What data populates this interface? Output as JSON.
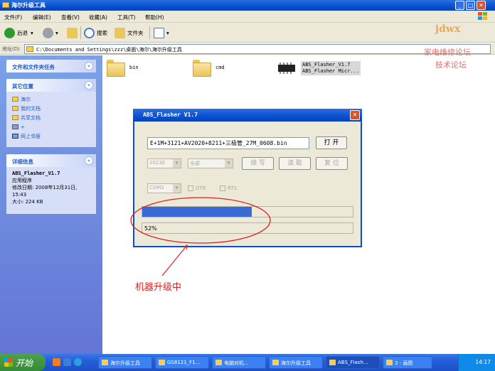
{
  "window": {
    "title": "海尔升级工具"
  },
  "menu": [
    "文件(F)",
    "编辑(E)",
    "查看(V)",
    "收藏(A)",
    "工具(T)",
    "帮助(H)"
  ],
  "toolbar": {
    "back": "后退",
    "search": "搜索",
    "folders": "文件夹"
  },
  "address": {
    "label": "地址(D)",
    "path": "C:\\Documents and Settings\\zzz\\桌面\\海尔\\海尔升级工具"
  },
  "sidebar": {
    "tasks_title": "文件和文件夹任务",
    "other_title": "其它位置",
    "other_items": [
      "海尔",
      "我的文档",
      "共享文档",
      "+",
      "网上邻居"
    ],
    "details_title": "详细信息",
    "details": {
      "name": "ABS_Flasher_V1.7",
      "type": "应用程序",
      "modified": "修改日期: 2008年12月31日, 15:43",
      "size": "大小: 224 KB"
    }
  },
  "files": [
    {
      "name": "bin"
    },
    {
      "name": "cmd"
    },
    {
      "name": "ABS_Flasher_V1.7",
      "sub": "ABS_Flasher Micr..."
    }
  ],
  "dialog": {
    "title": "ABS_Flasher V1.7",
    "file_field": "E+1M+3121+AV2020+8211+三极管_27M_0608.bin",
    "open_btn": "打 开",
    "chip_select": "2023E",
    "mode_select": "全部",
    "write_btn": "烧 写",
    "read_btn": "读 取",
    "reset_btn": "复 位",
    "port_select": "COM2",
    "dtr": "DTR",
    "rts": "RTS",
    "progress": 0.52,
    "status": "52%"
  },
  "annotation": "机器升级中",
  "watermark": {
    "logo": "jdwx",
    "line1": "家电维修论坛",
    "line2": "技术论坛"
  },
  "taskbar": {
    "start": "开始",
    "tasks": [
      "海尔升级工具",
      "GS8121_F1...",
      "电脑对机...",
      "海尔升级工具",
      "ABS_Flash...",
      "3 - 画图"
    ],
    "clock": "14:17"
  }
}
